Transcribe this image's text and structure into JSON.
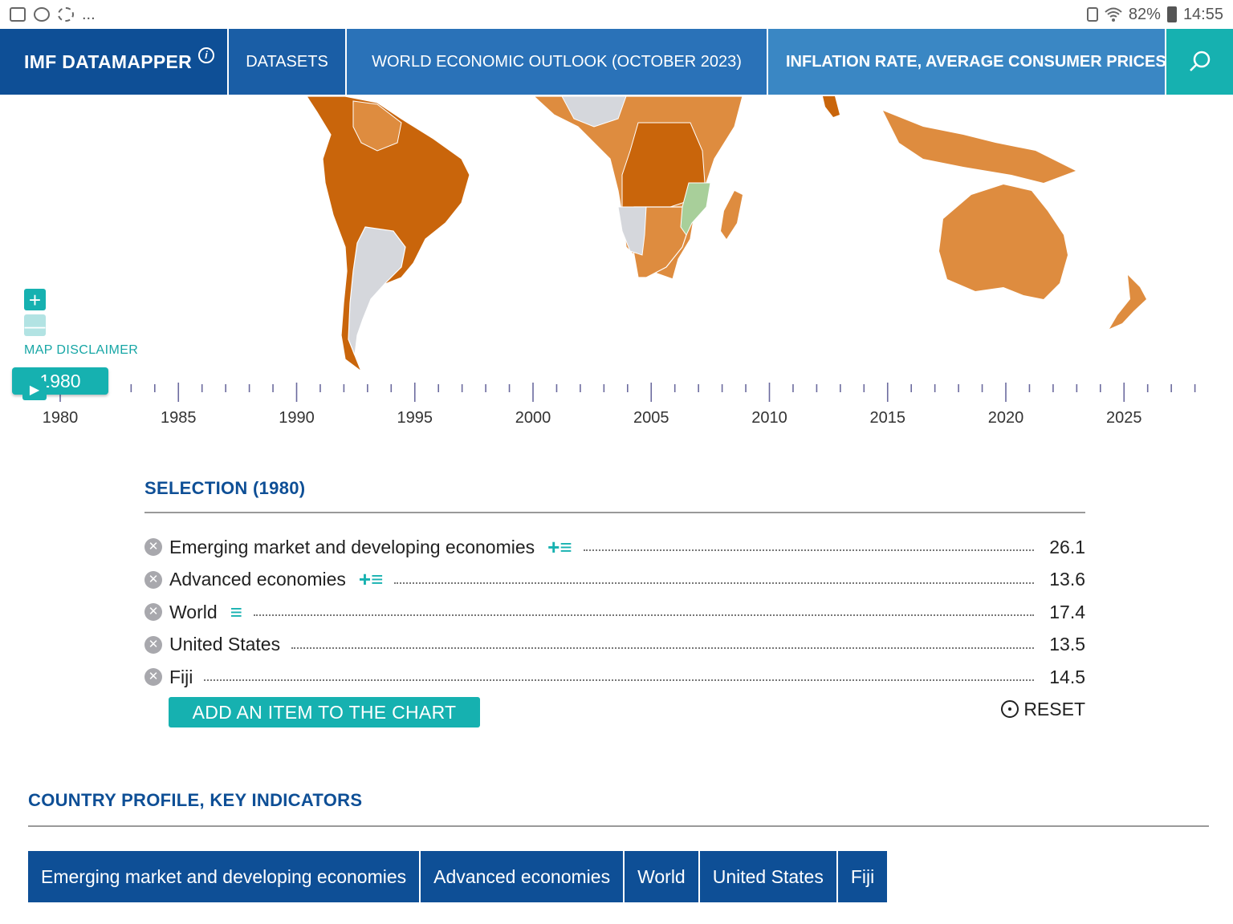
{
  "statusbar": {
    "icons": [
      "image-icon",
      "sync-icon",
      "weather-icon"
    ],
    "more": "...",
    "battery_pct": "82%",
    "time": "14:55"
  },
  "nav": {
    "brand": "IMF DATAMAPPER",
    "info_icon": "i",
    "datasets": "DATASETS",
    "dataset_name": "WORLD ECONOMIC OUTLOOK (OCTOBER 2023)",
    "indicator": "INFLATION RATE, AVERAGE CONSUMER PRICES",
    "search_icon": "search-icon"
  },
  "colors": {
    "brand": "#0e4f96",
    "accent": "#16b1b0",
    "high": "#c9650b",
    "mid": "#de8c3f",
    "low": "#a8cf9a",
    "nodata": "#d5d7dc"
  },
  "map": {
    "zoom_in": "+",
    "zoom_out": "—",
    "disclaimer": "MAP DISCLAIMER"
  },
  "timeline": {
    "current_year": "1980",
    "play_icon": "▶",
    "start": 1980,
    "end": 2028,
    "labels": [
      "1980",
      "1985",
      "1990",
      "1995",
      "2000",
      "2005",
      "2010",
      "2015",
      "2020",
      "2025"
    ]
  },
  "selection": {
    "title": "SELECTION (1980)",
    "rows": [
      {
        "label": "Emerging market and developing economies",
        "tools": "+≡",
        "value": "26.1"
      },
      {
        "label": "Advanced economies",
        "tools": "+≡",
        "value": "13.6"
      },
      {
        "label": "World",
        "tools": "≡",
        "value": "17.4"
      },
      {
        "label": "United States",
        "tools": "",
        "value": "13.5"
      },
      {
        "label": "Fiji",
        "tools": "",
        "value": "14.5"
      }
    ],
    "add_button": "ADD AN ITEM TO THE CHART",
    "reset": "RESET"
  },
  "profile": {
    "title": "COUNTRY PROFILE, KEY INDICATORS",
    "tabs": [
      "Emerging market and developing economies",
      "Advanced economies",
      "World",
      "United States",
      "Fiji"
    ]
  }
}
